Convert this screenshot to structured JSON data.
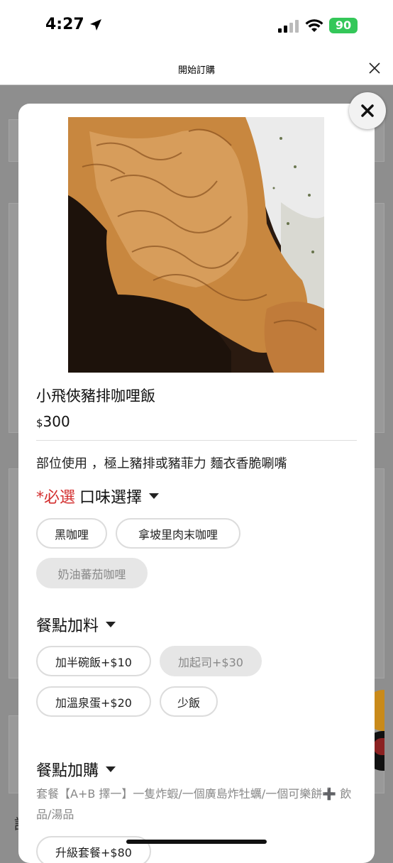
{
  "status": {
    "time": "4:27",
    "battery": "90"
  },
  "nav": {
    "title": "開始訂購"
  },
  "background": {
    "text": "請"
  },
  "item": {
    "title": "小飛俠豬排咖哩飯",
    "currency": "$",
    "price": "300",
    "description": "部位使用 ，極上豬排或豬菲力 麵衣香脆唰嘴"
  },
  "flavor": {
    "required": "*必選",
    "label": "口味選擇",
    "options": [
      {
        "label": "黑咖哩",
        "disabled": false
      },
      {
        "label": "拿坡里肉末咖哩",
        "disabled": false
      },
      {
        "label": "奶油蕃茄咖哩",
        "disabled": true
      }
    ]
  },
  "toppings": {
    "label": "餐點加料",
    "options": [
      {
        "label": "加半碗飯+$10",
        "disabled": false
      },
      {
        "label": "加起司+$30",
        "disabled": true
      },
      {
        "label": "加溫泉蛋+$20",
        "disabled": false
      },
      {
        "label": "少飯",
        "disabled": false
      }
    ]
  },
  "addons": {
    "label": "餐點加購",
    "description": "套餐【A+B 擇一】一隻炸蝦/一個廣島炸牡蠣/一個可樂餅➕ 飲品/湯品",
    "options": [
      {
        "label": "升級套餐+$80",
        "disabled": false
      }
    ]
  },
  "colors": {
    "required": "#d32f2f",
    "battery": "#34c759"
  }
}
